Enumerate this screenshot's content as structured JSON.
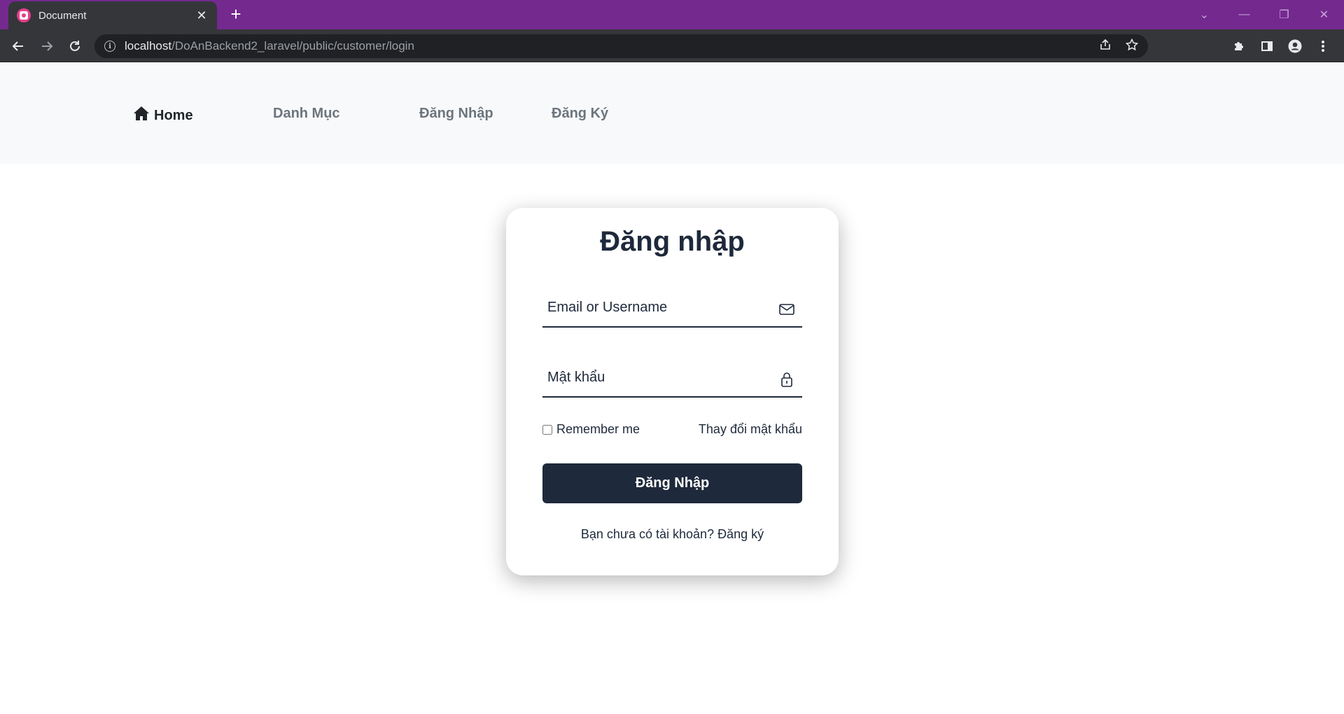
{
  "browser": {
    "tab_title": "Document",
    "tab_close": "✕",
    "new_tab": "+",
    "url_host": "localhost",
    "url_path": "/DoAnBackend2_laravel/public/customer/login",
    "win_chevron": "⌄",
    "win_minimize": "—",
    "win_restore": "❐",
    "win_close": "✕"
  },
  "nav": {
    "home": "Home",
    "category": "Danh Mục",
    "login": "Đăng Nhập",
    "register": "Đăng Ký"
  },
  "login_form": {
    "title": "Đăng nhập",
    "email_placeholder": "Email or Username",
    "password_placeholder": "Mật khẩu",
    "remember_label": "Remember me",
    "change_password": "Thay đổi mật khẩu",
    "submit_label": "Đăng Nhập",
    "no_account_text": "Bạn chưa có tài khoản? ",
    "register_link": "Đăng ký"
  },
  "colors": {
    "tabbar": "#74298f",
    "primary": "#1e293b",
    "nav_bg": "#f8f9fa"
  },
  "icons": [
    "app-favicon-icon",
    "back-arrow-icon",
    "forward-arrow-icon",
    "reload-icon",
    "info-icon",
    "share-icon",
    "star-icon",
    "puzzle-icon",
    "sidepanel-icon",
    "profile-icon",
    "menu-dots-icon",
    "home-icon",
    "envelope-icon",
    "lock-icon"
  ]
}
